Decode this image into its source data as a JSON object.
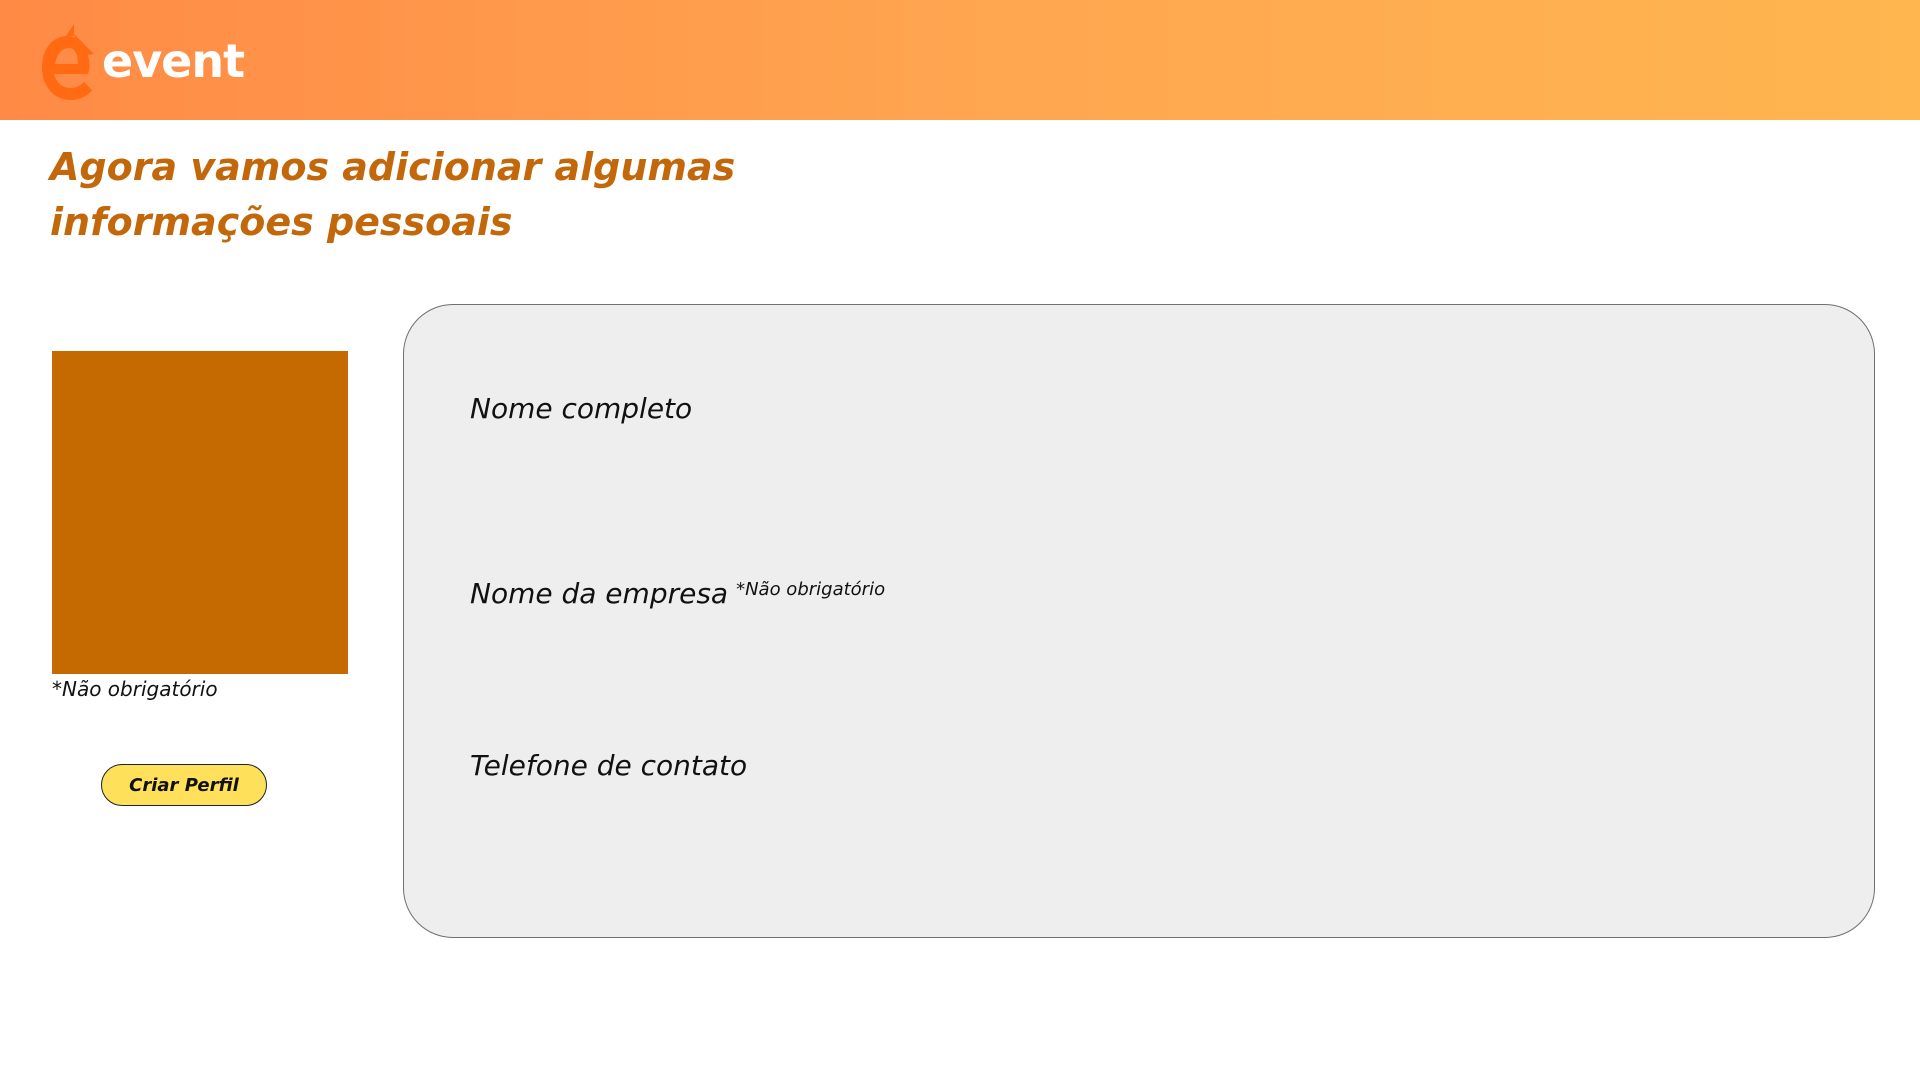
{
  "brand": {
    "name": "event",
    "logo_icon": "e-arrow-logo-icon",
    "colors": {
      "header_start": "#ff8a45",
      "header_end": "#ffb64f",
      "title": "#c2680a",
      "photo_placeholder": "#c46a00",
      "button": "#ffe05a",
      "panel": "#eeeeee"
    }
  },
  "page": {
    "title_line1": "Agora vamos adicionar algumas",
    "title_line2": "informações pessoais"
  },
  "photo": {
    "note": "*Não obrigatório"
  },
  "actions": {
    "create_profile_label": "Criar Perfil"
  },
  "form": {
    "full_name": {
      "label": "Nome completo",
      "value": ""
    },
    "company_name": {
      "label": "Nome da empresa",
      "note": "*Não obrigatório",
      "value": ""
    },
    "phone": {
      "label": "Telefone de contato",
      "value": ""
    }
  }
}
